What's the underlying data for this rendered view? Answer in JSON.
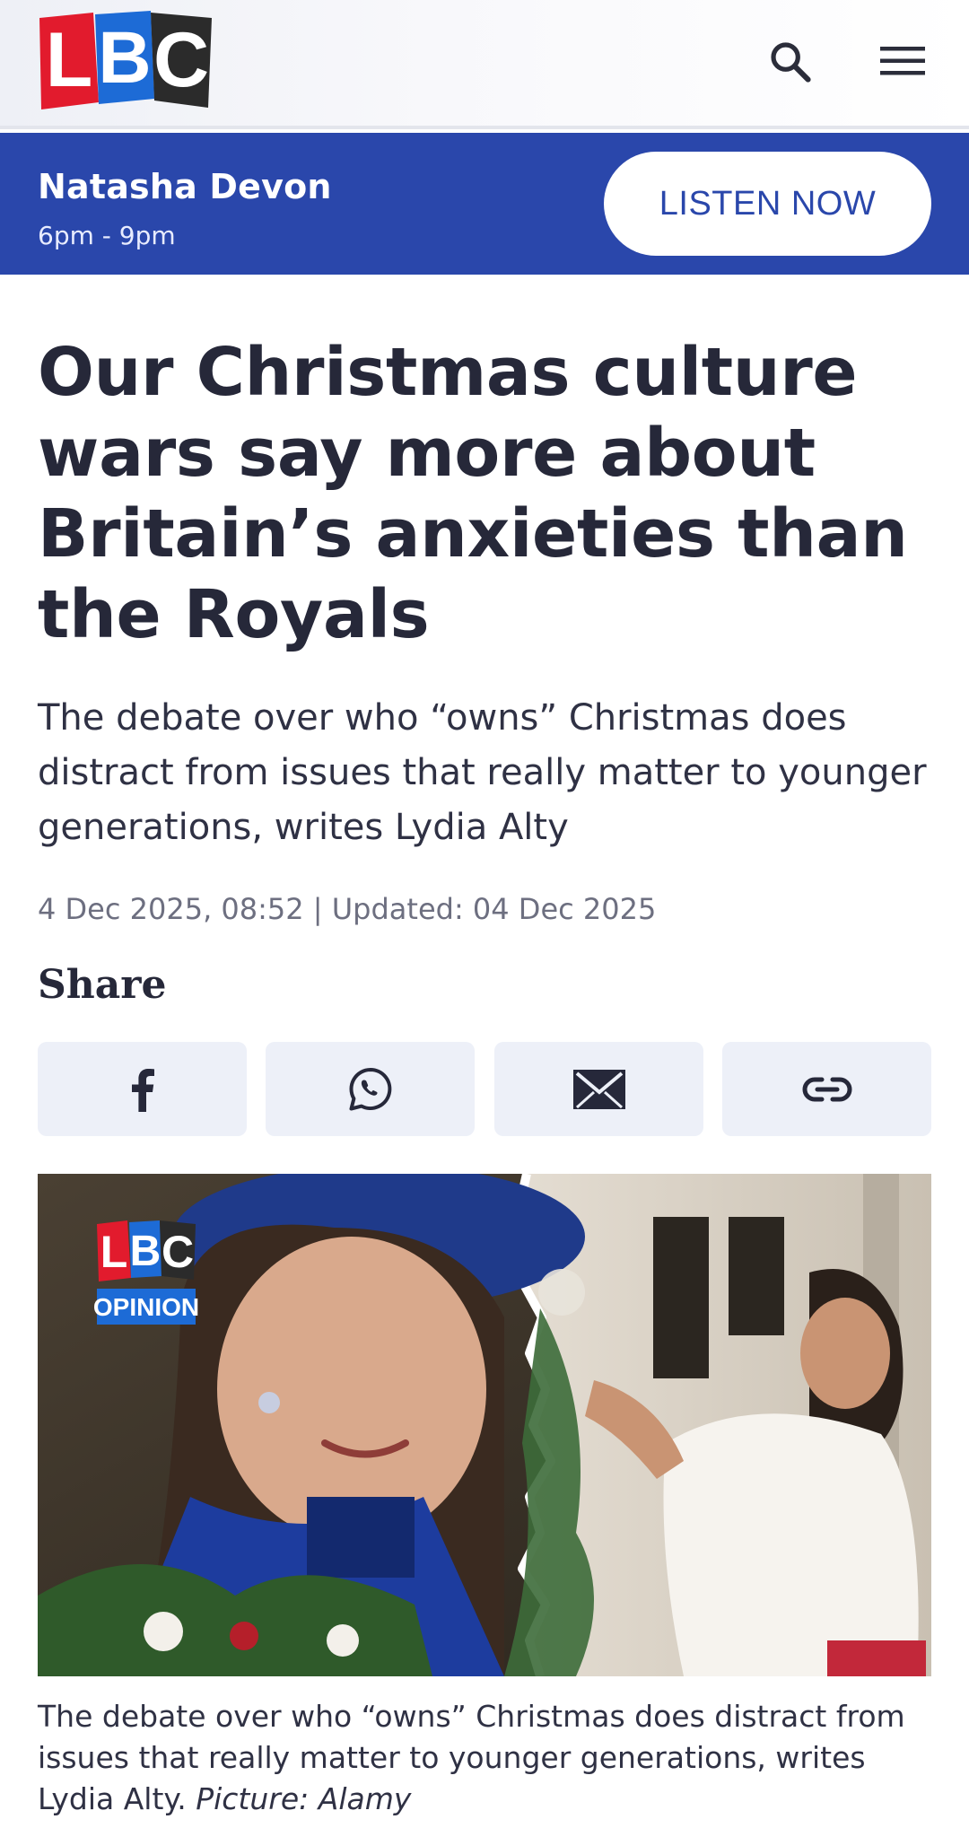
{
  "header": {
    "logo_letters": [
      "L",
      "B",
      "C"
    ],
    "search_icon": "search-icon",
    "menu_icon": "hamburger-menu-icon"
  },
  "live_bar": {
    "presenter": "Natasha Devon",
    "time": "6pm - 9pm",
    "listen_label": "LISTEN NOW"
  },
  "article": {
    "headline": "Our Christmas culture wars say more about Britain’s anxieties than the Royals",
    "standfirst": "The debate over who “owns” Christmas does distract from issues that really matter to younger generations, writes Lydia Alty",
    "meta": "4 Dec 2025, 08:52 | Updated: 04 Dec 2025",
    "share_title": "Share",
    "share_buttons": [
      {
        "icon": "facebook-icon"
      },
      {
        "icon": "whatsapp-icon"
      },
      {
        "icon": "email-icon"
      },
      {
        "icon": "link-icon"
      }
    ],
    "image_badge": {
      "letters": [
        "L",
        "B",
        "C"
      ],
      "label": "OPINION"
    },
    "caption": "The debate over who “owns” Christmas does distract from issues that really matter to younger generations, writes Lydia Alty.",
    "caption_credit": "Picture: Alamy"
  },
  "colors": {
    "brand_blue": "#2a47ab",
    "logo_red": "#e21b2d",
    "logo_blue": "#1d6bd6",
    "logo_dark": "#2b2b2b",
    "text_dark": "#262839",
    "share_bg": "#edf0f8"
  }
}
